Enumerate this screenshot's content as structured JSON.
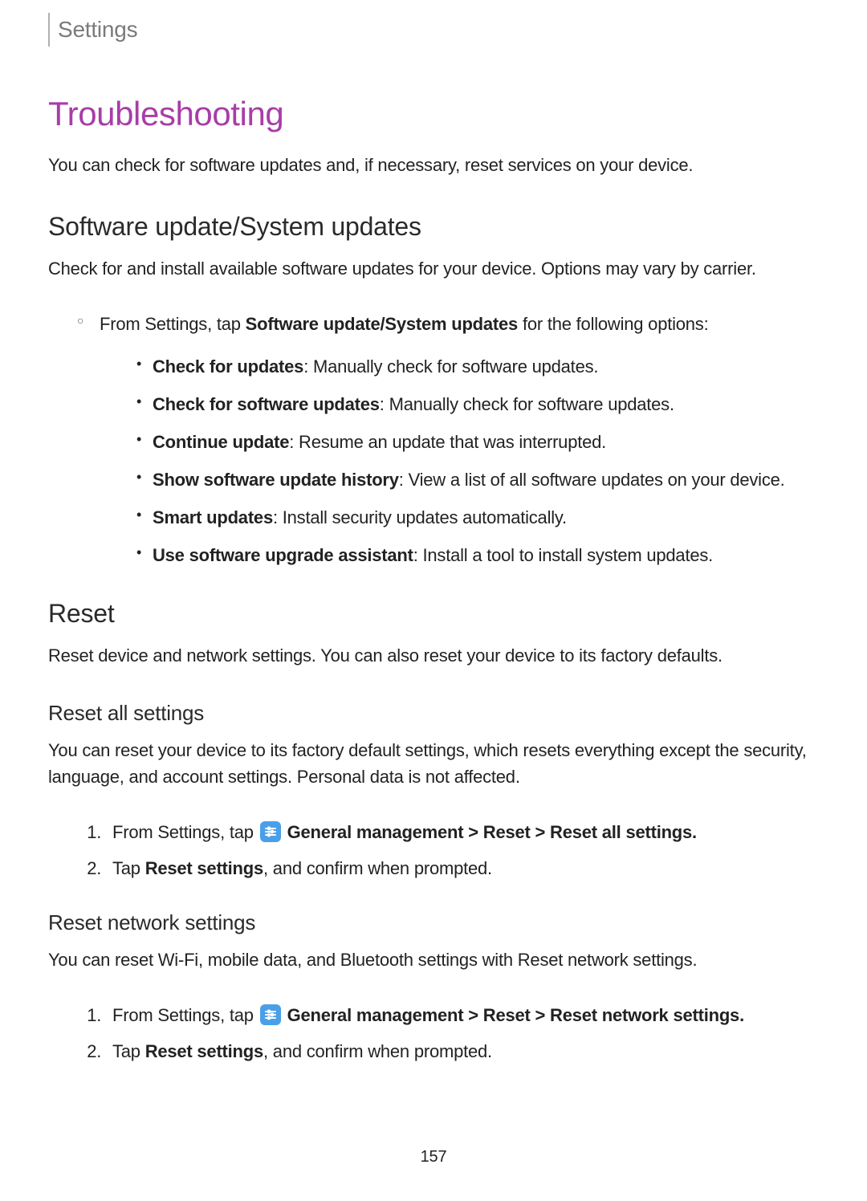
{
  "topLabel": "Settings",
  "title": "Troubleshooting",
  "intro": "You can check for software updates and, if necessary, reset services on your device.",
  "softwareUpdate": {
    "heading": "Software update/System updates",
    "lead": "Check for and install available software updates for your device. Options may vary by carrier.",
    "fromSettingsPrefix": "From Settings, tap ",
    "fromSettingsBold": "Software update/System updates",
    "fromSettingsSuffix": " for the following options:",
    "items": [
      {
        "label": "Check for updates",
        "desc": ": Manually check for software updates."
      },
      {
        "label": "Check for software updates",
        "desc": ": Manually check for software updates."
      },
      {
        "label": "Continue update",
        "desc": ": Resume an update that was interrupted."
      },
      {
        "label": "Show software update history",
        "desc": ": View a list of all software updates on your device."
      },
      {
        "label": "Smart updates",
        "desc": ": Install security updates automatically."
      },
      {
        "label": "Use software upgrade assistant",
        "desc": ": Install a tool to install system updates."
      }
    ]
  },
  "reset": {
    "heading": "Reset",
    "lead": "Reset device and network settings. You can also reset your device to its factory defaults.",
    "all": {
      "heading": "Reset all settings",
      "lead": "You can reset your device to its factory default settings, which resets everything except the security, language, and account settings. Personal data is not affected.",
      "step1prefix": "From Settings, tap ",
      "step1path1": "General management",
      "sep": " > ",
      "step1path2": "Reset",
      "step1path3": "Reset all settings",
      "period": ".",
      "step2prefix": "Tap ",
      "step2bold": "Reset settings",
      "step2suffix": ", and confirm when prompted."
    },
    "network": {
      "heading": "Reset network settings",
      "lead": "You can reset Wi-Fi, mobile data, and Bluetooth settings with Reset network settings.",
      "step1prefix": "From Settings, tap ",
      "step1path1": "General management",
      "step1path2": "Reset",
      "step1path3": "Reset network settings",
      "step2prefix": "Tap ",
      "step2bold": "Reset settings",
      "step2suffix": ", and confirm when prompted."
    }
  },
  "pageNumber": "157"
}
